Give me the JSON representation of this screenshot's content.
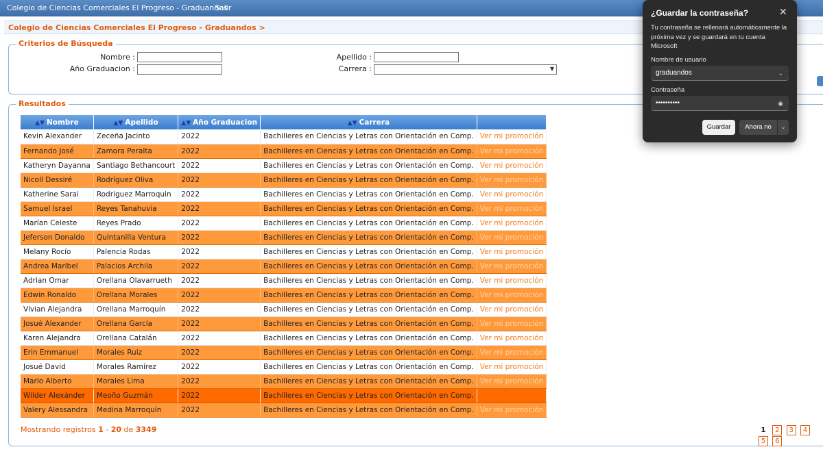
{
  "topbar": {
    "app_title": "Colegio de Ciencias Comerciales El Progreso - Graduandos",
    "exit": "Salir"
  },
  "breadcrumb": "Colegio de Ciencias Comerciales El Progreso - Graduandos >",
  "search": {
    "legend": "Criterios de Búsqueda",
    "nombre_label": "Nombre :",
    "apellido_label": "Apellido :",
    "anio_label": "Año Graduacion :",
    "carrera_label": "Carrera :",
    "nombre_value": "",
    "apellido_value": "",
    "anio_value": "",
    "carrera_value": ""
  },
  "results": {
    "legend": "Resultados",
    "columns": [
      "Nombre",
      "Apellido",
      "Año Graduacion",
      "Carrera"
    ],
    "sort_icon": "▲▼",
    "rows": [
      {
        "nombre": "Kevin Alexander",
        "apellido": "Zeceña Jacinto",
        "anio": "2022",
        "carrera": "Bachilleres en Ciencias y Letras con Orientación en Comp.",
        "link": "Ver mi promoción"
      },
      {
        "nombre": "Fernando José",
        "apellido": "Zamora Peralta",
        "anio": "2022",
        "carrera": "Bachilleres en Ciencias y Letras con Orientación en Comp.",
        "link": "Ver mi promoción"
      },
      {
        "nombre": "Katheryn Dayanna",
        "apellido": "Santiago Bethancourt",
        "anio": "2022",
        "carrera": "Bachilleres en Ciencias y Letras con Orientación en Comp.",
        "link": "Ver mi promoción"
      },
      {
        "nombre": "Nicoll Dessiré",
        "apellido": "Rodríguez Oliva",
        "anio": "2022",
        "carrera": "Bachilleres en Ciencias y Letras con Orientación en Comp.",
        "link": "Ver mi promoción"
      },
      {
        "nombre": "Katherine Sarai",
        "apellido": "Rodriguez Marroquin",
        "anio": "2022",
        "carrera": "Bachilleres en Ciencias y Letras con Orientación en Comp.",
        "link": "Ver mi promoción"
      },
      {
        "nombre": "Samuel Israel",
        "apellido": "Reyes Tanahuvia",
        "anio": "2022",
        "carrera": "Bachilleres en Ciencias y Letras con Orientación en Comp.",
        "link": "Ver mi promoción"
      },
      {
        "nombre": "Marían Celeste",
        "apellido": "Reyes Prado",
        "anio": "2022",
        "carrera": "Bachilleres en Ciencias y Letras con Orientación en Comp.",
        "link": "Ver mi promoción"
      },
      {
        "nombre": "Jeferson Donaldo",
        "apellido": "Quintanilla Ventura",
        "anio": "2022",
        "carrera": "Bachilleres en Ciencias y Letras con Orientación en Comp.",
        "link": "Ver mi promoción"
      },
      {
        "nombre": "Melany Rocío",
        "apellido": "Palencia Rodas",
        "anio": "2022",
        "carrera": "Bachilleres en Ciencias y Letras con Orientación en Comp.",
        "link": "Ver mi promoción"
      },
      {
        "nombre": "Andrea Maribel",
        "apellido": "Palacios Archila",
        "anio": "2022",
        "carrera": "Bachilleres en Ciencias y Letras con Orientación en Comp.",
        "link": "Ver mi promoción"
      },
      {
        "nombre": "Adrian Omar",
        "apellido": "Orellana Olavarrueth",
        "anio": "2022",
        "carrera": "Bachilleres en Ciencias y Letras con Orientación en Comp.",
        "link": "Ver mi promoción"
      },
      {
        "nombre": "Edwin Ronaldo",
        "apellido": "Orellana Morales",
        "anio": "2022",
        "carrera": "Bachilleres en Ciencias y Letras con Orientación en Comp.",
        "link": "Ver mi promoción"
      },
      {
        "nombre": "Vivian Alejandra",
        "apellido": "Orellana Marroquín",
        "anio": "2022",
        "carrera": "Bachilleres en Ciencias y Letras con Orientación en Comp.",
        "link": "Ver mi promoción"
      },
      {
        "nombre": "Josué Alexander",
        "apellido": "Orellana García",
        "anio": "2022",
        "carrera": "Bachilleres en Ciencias y Letras con Orientación en Comp.",
        "link": "Ver mi promoción"
      },
      {
        "nombre": "Karen Alejandra",
        "apellido": "Orellana Catalán",
        "anio": "2022",
        "carrera": "Bachilleres en Ciencias y Letras con Orientación en Comp.",
        "link": "Ver mi promoción"
      },
      {
        "nombre": "Erin Emmanuel",
        "apellido": "Morales Ruiz",
        "anio": "2022",
        "carrera": "Bachilleres en Ciencias y Letras con Orientación en Comp.",
        "link": "Ver mi promoción"
      },
      {
        "nombre": "Josué David",
        "apellido": "Morales Ramírez",
        "anio": "2022",
        "carrera": "Bachilleres en Ciencias y Letras con Orientación en Comp.",
        "link": "Ver mi promoción"
      },
      {
        "nombre": "Mario Alberto",
        "apellido": "Morales Lima",
        "anio": "2022",
        "carrera": "Bachilleres en Ciencias y Letras con Orientación en Comp.",
        "link": "Ver mi promoción"
      },
      {
        "nombre": "Wilder Alexánder",
        "apellido": "Meoño Guzmán",
        "anio": "2022",
        "carrera": "Bachilleres en Ciencias y Letras con Orientación en Comp.",
        "link": ""
      },
      {
        "nombre": "Valery Alessandra",
        "apellido": "Medina Marroquín",
        "anio": "2022",
        "carrera": "Bachilleres en Ciencias y Letras con Orientación en Comp.",
        "link": "Ver mi promoción"
      }
    ],
    "count_prefix": "Mostrando registros ",
    "count_from": "1",
    "count_sep": " - ",
    "count_to": "20",
    "count_of": " de ",
    "count_total": "3349",
    "pages": [
      "1",
      "2",
      "3",
      "4",
      "5",
      "6"
    ]
  },
  "password_dialog": {
    "title": "¿Guardar la contraseña?",
    "description": "Tu contraseña se rellenará automáticamente la próxima vez y se guardará en tu cuenta Microsoft",
    "username_label": "Nombre de usuario",
    "username_value": "graduandos",
    "password_label": "Contraseña",
    "password_value": "••••••••••",
    "save_button": "Guardar",
    "not_now_button": "Ahora no"
  },
  "colors": {
    "topbar": "#3f70ad",
    "accent_orange": "#e05a0b",
    "row_alt": "#ff9a3c",
    "row_selected": "#ff6a00",
    "dialog_bg": "#2b2b2b"
  }
}
